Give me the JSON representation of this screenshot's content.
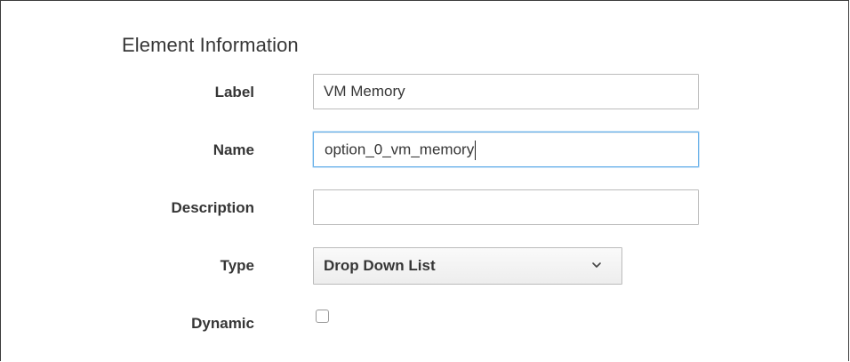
{
  "section": {
    "title": "Element Information"
  },
  "fields": {
    "label": {
      "label": "Label",
      "value": "VM Memory"
    },
    "name": {
      "label": "Name",
      "value": "option_0_vm_memory"
    },
    "description": {
      "label": "Description",
      "value": ""
    },
    "type": {
      "label": "Type",
      "selected": "Drop Down List",
      "icon": "chevron-down-icon"
    },
    "dynamic": {
      "label": "Dynamic",
      "checked": false
    }
  },
  "colors": {
    "focus_border": "#66afe9",
    "input_border": "#bbbbbb",
    "text": "#363636"
  }
}
